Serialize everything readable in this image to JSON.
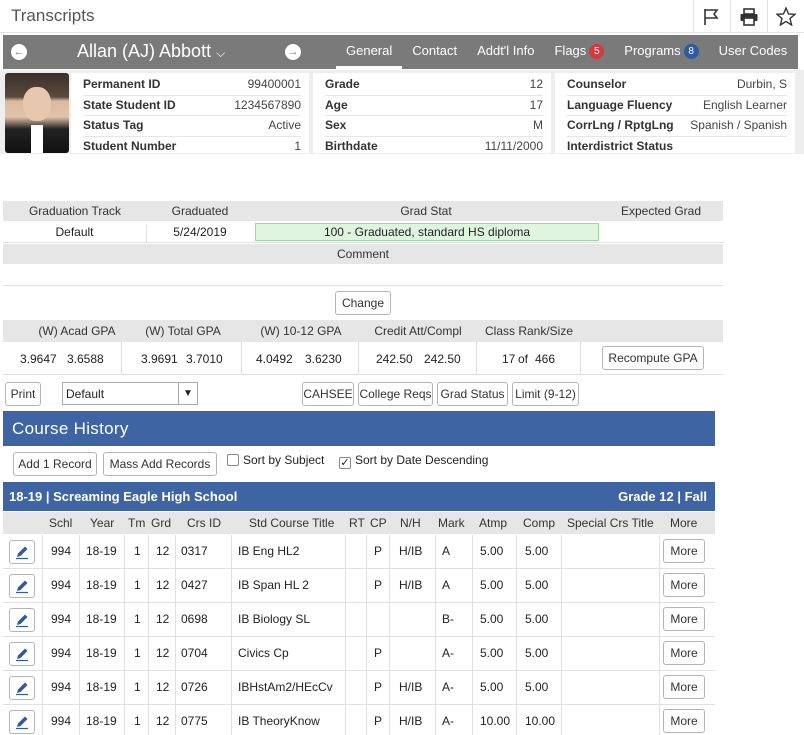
{
  "header": {
    "title": "Transcripts"
  },
  "student": {
    "name": "Allan (AJ) Abbott",
    "tabs": [
      {
        "label": "General",
        "active": true
      },
      {
        "label": "Contact"
      },
      {
        "label": "Addt'l Info"
      },
      {
        "label": "Flags",
        "badge": "5"
      },
      {
        "label": "Programs",
        "badge": "8"
      },
      {
        "label": "User Codes"
      }
    ]
  },
  "info": {
    "col1": [
      {
        "label": "Permanent ID",
        "value": "99400001"
      },
      {
        "label": "State Student ID",
        "value": "1234567890"
      },
      {
        "label": "Status Tag",
        "value": "Active"
      },
      {
        "label": "Student Number",
        "value": "1"
      }
    ],
    "col2": [
      {
        "label": "Grade",
        "value": "12"
      },
      {
        "label": "Age",
        "value": "17"
      },
      {
        "label": "Sex",
        "value": "M"
      },
      {
        "label": "Birthdate",
        "value": "11/11/2000"
      }
    ],
    "col3": [
      {
        "label": "Counselor",
        "value": "Durbin, S"
      },
      {
        "label": "Language Fluency",
        "value": "English Learner"
      },
      {
        "label": "CorrLng / RptgLng",
        "value": "Spanish / Spanish"
      },
      {
        "label": "Interdistrict Status",
        "value": ""
      }
    ]
  },
  "graduation": {
    "headers": [
      "Graduation Track",
      "Graduated",
      "Grad Stat",
      "Expected Grad"
    ],
    "track": "Default",
    "graduated": "5/24/2019",
    "grad_stat": "100 - Graduated, standard HS diploma",
    "expected": "",
    "comment_label": "Comment",
    "comment": "",
    "change_label": "Change"
  },
  "gpa": {
    "headers": [
      "(W) Acad GPA",
      "(W) Total GPA",
      "(W) 10-12 GPA",
      "Credit Att/Compl",
      "Class Rank/Size"
    ],
    "acad": [
      "3.9647",
      "3.6588"
    ],
    "total": [
      "3.9691",
      "3.7010"
    ],
    "g1012": [
      "4.0492",
      "3.6230"
    ],
    "credit": [
      "242.50",
      "242.50"
    ],
    "rank": "17",
    "of": "of",
    "size": "466",
    "recompute_label": "Recompute GPA"
  },
  "toolbar": {
    "print_label": "Print",
    "select_value": "Default",
    "buttons": [
      "CAHSEE",
      "College Reqs",
      "Grad Status",
      "Limit (9-12)"
    ]
  },
  "course_history": {
    "title": "Course History",
    "add_label": "Add 1 Record",
    "mass_add_label": "Mass Add Records",
    "sort_subject_label": "Sort by Subject",
    "sort_subject_checked": false,
    "sort_date_label": "Sort by Date Descending",
    "sort_date_checked": true,
    "school_left": "18-19 | Screaming Eagle High School",
    "school_right": "Grade 12 | Fall",
    "columns": [
      "Schl",
      "Year",
      "Tm",
      "Grd",
      "Crs ID",
      "Std Course Title",
      "RT",
      "CP",
      "N/H",
      "Mark",
      "Atmp",
      "Comp",
      "Special Crs Title",
      "More"
    ],
    "more_label": "More",
    "rows": [
      {
        "schl": "994",
        "year": "18-19",
        "tm": "1",
        "grd": "12",
        "crs": "0317",
        "title": "IB Eng HL2",
        "rt": "",
        "cp": "P",
        "nh": "H/IB",
        "mark": "A",
        "atmp": "5.00",
        "comp": "5.00",
        "special": ""
      },
      {
        "schl": "994",
        "year": "18-19",
        "tm": "1",
        "grd": "12",
        "crs": "0427",
        "title": "IB Span HL 2",
        "rt": "",
        "cp": "P",
        "nh": "H/IB",
        "mark": "A",
        "atmp": "5.00",
        "comp": "5.00",
        "special": ""
      },
      {
        "schl": "994",
        "year": "18-19",
        "tm": "1",
        "grd": "12",
        "crs": "0698",
        "title": "IB Biology SL",
        "rt": "",
        "cp": "",
        "nh": "",
        "mark": "B-",
        "atmp": "5.00",
        "comp": "5.00",
        "special": ""
      },
      {
        "schl": "994",
        "year": "18-19",
        "tm": "1",
        "grd": "12",
        "crs": "0704",
        "title": "Civics Cp",
        "rt": "",
        "cp": "P",
        "nh": "",
        "mark": "A-",
        "atmp": "5.00",
        "comp": "5.00",
        "special": ""
      },
      {
        "schl": "994",
        "year": "18-19",
        "tm": "1",
        "grd": "12",
        "crs": "0726",
        "title": "IBHstAm2/HEcCv",
        "rt": "",
        "cp": "P",
        "nh": "H/IB",
        "mark": "A-",
        "atmp": "5.00",
        "comp": "5.00",
        "special": ""
      },
      {
        "schl": "994",
        "year": "18-19",
        "tm": "1",
        "grd": "12",
        "crs": "0775",
        "title": "IB TheoryKnow",
        "rt": "",
        "cp": "P",
        "nh": "H/IB",
        "mark": "A-",
        "atmp": "10.00",
        "comp": "10.00",
        "special": ""
      }
    ]
  }
}
